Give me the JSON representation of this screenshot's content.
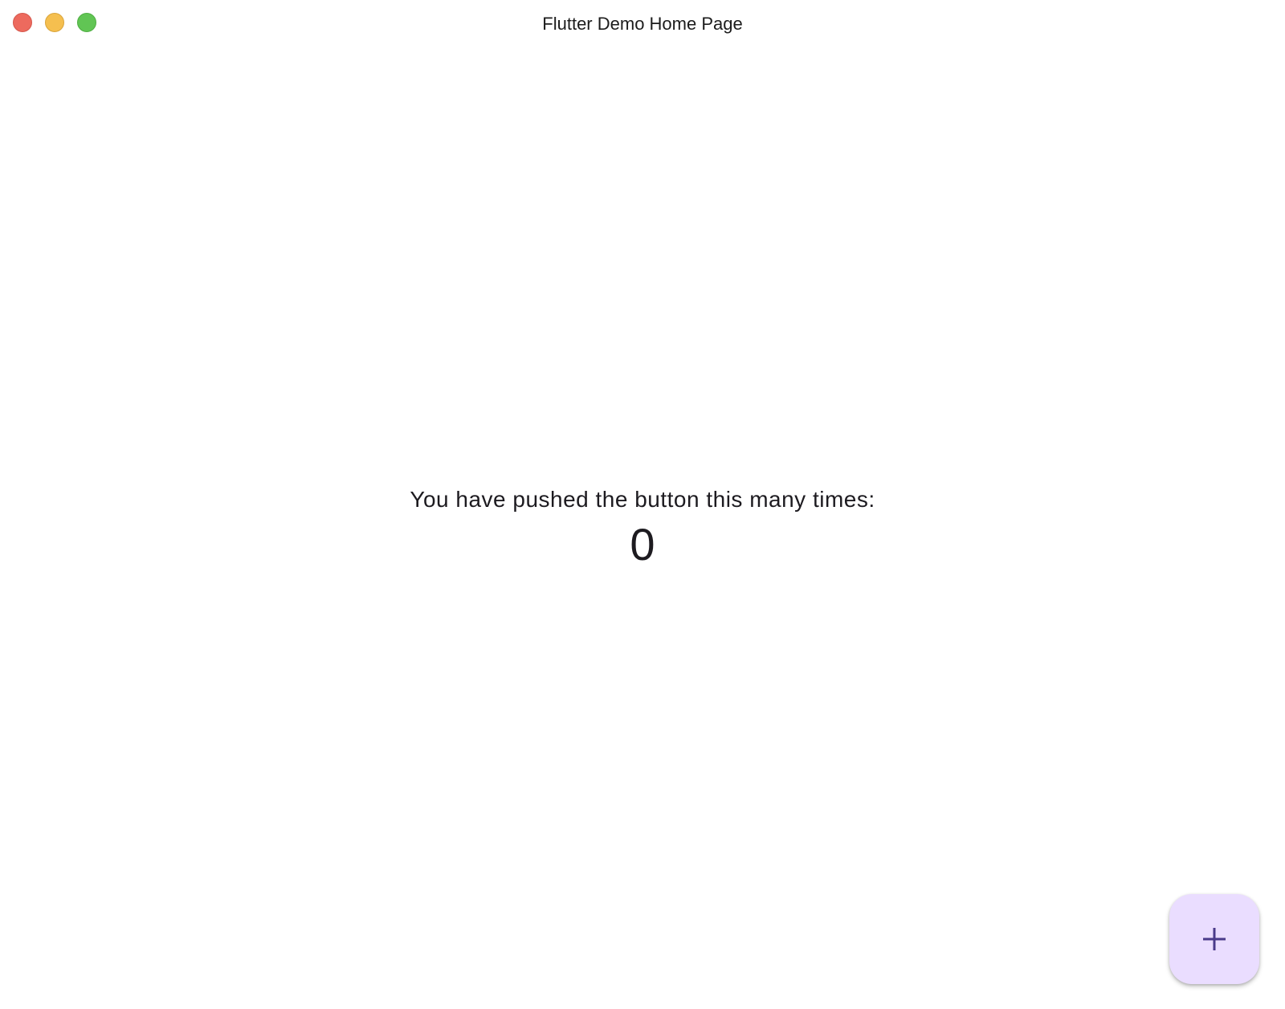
{
  "window": {
    "title": "Flutter Demo Home Page"
  },
  "main": {
    "message": "You have pushed the button this many times:",
    "counter": "0"
  },
  "fab": {
    "icon": "add-icon",
    "background_color": "#eaddff",
    "icon_color": "#4a3a8a"
  },
  "colors": {
    "close": "#ed6a5e",
    "minimize": "#f5bf4f",
    "zoom": "#61c554"
  }
}
